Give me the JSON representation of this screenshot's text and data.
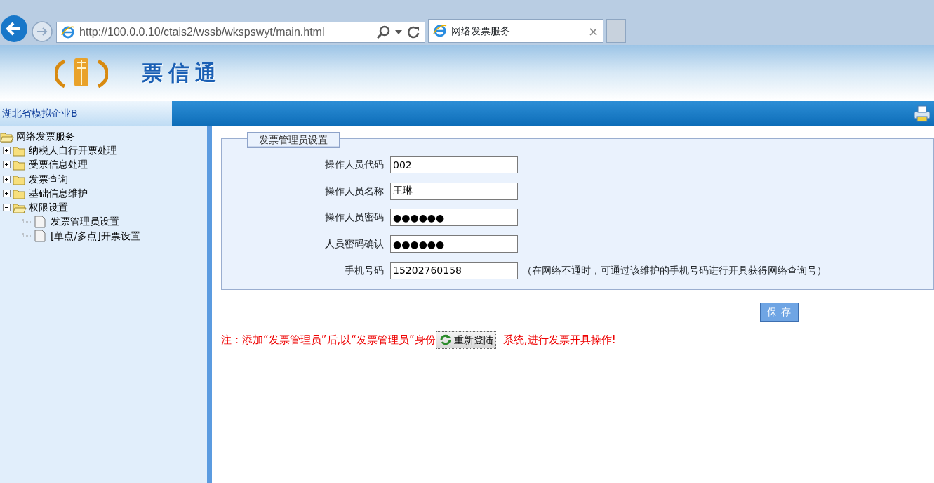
{
  "browser": {
    "address": "http://100.0.0.10/ctais2/wssb/wkspswyt/main.html",
    "tab_title": "网络发票服务",
    "tab_close": "×"
  },
  "banner": {
    "title": "票信通"
  },
  "header_bar": {
    "company": "湖北省模拟企业B"
  },
  "tree": [
    {
      "label": "网络发票服务",
      "kind": "folder",
      "expanded": true,
      "children": [
        {
          "label": "纳税人自行开票处理",
          "kind": "folder",
          "expanded": false
        },
        {
          "label": "受票信息处理",
          "kind": "folder",
          "expanded": false
        },
        {
          "label": "发票查询",
          "kind": "folder",
          "expanded": false
        },
        {
          "label": "基础信息维护",
          "kind": "folder",
          "expanded": false
        },
        {
          "label": "权限设置",
          "kind": "folder",
          "expanded": true,
          "children": [
            {
              "label": "发票管理员设置",
              "kind": "page"
            },
            {
              "label": "[单点/多点]开票设置",
              "kind": "page"
            }
          ]
        }
      ]
    }
  ],
  "form": {
    "legend": "发票管理员设置",
    "fields": [
      {
        "label": "操作人员代码",
        "value": "002"
      },
      {
        "label": "操作人员名称",
        "value": "王琳"
      },
      {
        "label": "操作人员密码",
        "value": "●●●●●●"
      },
      {
        "label": "人员密码确认",
        "value": "●●●●●●"
      },
      {
        "label": "手机号码",
        "value": "15202760158",
        "hint": "（在网络不通时，可通过该维护的手机号码进行开具获得网络查询号）"
      }
    ]
  },
  "save_button": "保 存",
  "note": {
    "before": "注：添加“发票管理员”后,以“发票管理员”身份",
    "button": "重新登陆",
    "after": "系统,进行发票开具操作!"
  }
}
